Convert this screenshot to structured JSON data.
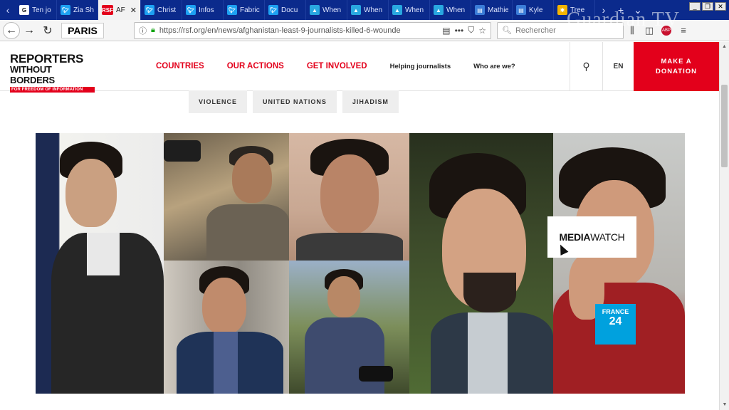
{
  "browser": {
    "tabs": [
      {
        "favicon": "G",
        "title": "Ten jo",
        "color": "#ffffff",
        "fg": "#111111"
      },
      {
        "favicon": "twitter-icon",
        "title": "Zia Sh",
        "color": "#1da1f2",
        "fg": "#ffffff"
      },
      {
        "favicon": "RSF",
        "title": "AF",
        "color": "#e3001b",
        "fg": "#ffffff",
        "active": true
      },
      {
        "favicon": "twitter-icon",
        "title": "Christ",
        "color": "#1da1f2",
        "fg": "#ffffff"
      },
      {
        "favicon": "twitter-icon",
        "title": "Infos",
        "color": "#1da1f2",
        "fg": "#ffffff"
      },
      {
        "favicon": "twitter-icon",
        "title": "Fabric",
        "color": "#1da1f2",
        "fg": "#ffffff"
      },
      {
        "favicon": "twitter-icon",
        "title": "Docu",
        "color": "#1da1f2",
        "fg": "#ffffff"
      },
      {
        "favicon": "tweetdeck-icon",
        "title": "When",
        "color": "#29a8e0",
        "fg": "#ffffff"
      },
      {
        "favicon": "tweetdeck-icon",
        "title": "When",
        "color": "#29a8e0",
        "fg": "#ffffff"
      },
      {
        "favicon": "tweetdeck-icon",
        "title": "When",
        "color": "#29a8e0",
        "fg": "#ffffff"
      },
      {
        "favicon": "tweetdeck-icon",
        "title": "When",
        "color": "#29a8e0",
        "fg": "#ffffff"
      },
      {
        "favicon": "doc-icon",
        "title": "Mathie",
        "color": "#3b7dd8",
        "fg": "#ffffff"
      },
      {
        "favicon": "doc-icon",
        "title": "Kyle",
        "color": "#3b7dd8",
        "fg": "#ffffff"
      },
      {
        "favicon": "nbc-icon",
        "title": "Tree",
        "color": "#f4b400",
        "fg": "#ffffff"
      }
    ],
    "paris_label": "PARIS",
    "url": "https://rsf.org/en/news/afghanistan-least-9-journalists-killed-6-wounde",
    "search_placeholder": "Rechercher",
    "watermark": "Guardian TV"
  },
  "site": {
    "logo": {
      "line1": "REPORTERS",
      "line2": "WITHOUT BORDERS",
      "line3": "FOR FREEDOM OF INFORMATION"
    },
    "nav_primary": [
      "COUNTRIES",
      "OUR ACTIONS",
      "GET INVOLVED"
    ],
    "nav_secondary": [
      "Helping journalists",
      "Who are we?"
    ],
    "lang": "EN",
    "donate_line1": "MAKE A",
    "donate_line2": "DONATION",
    "accent": "#e3001b"
  },
  "tags": [
    "VIOLENCE",
    "UNITED NATIONS",
    "JIHADISM"
  ],
  "overlay": {
    "mediawatch_a": "MEDIA",
    "mediawatch_b": "WATCH",
    "france24_top": "FRANCE",
    "france24_num": "24"
  }
}
